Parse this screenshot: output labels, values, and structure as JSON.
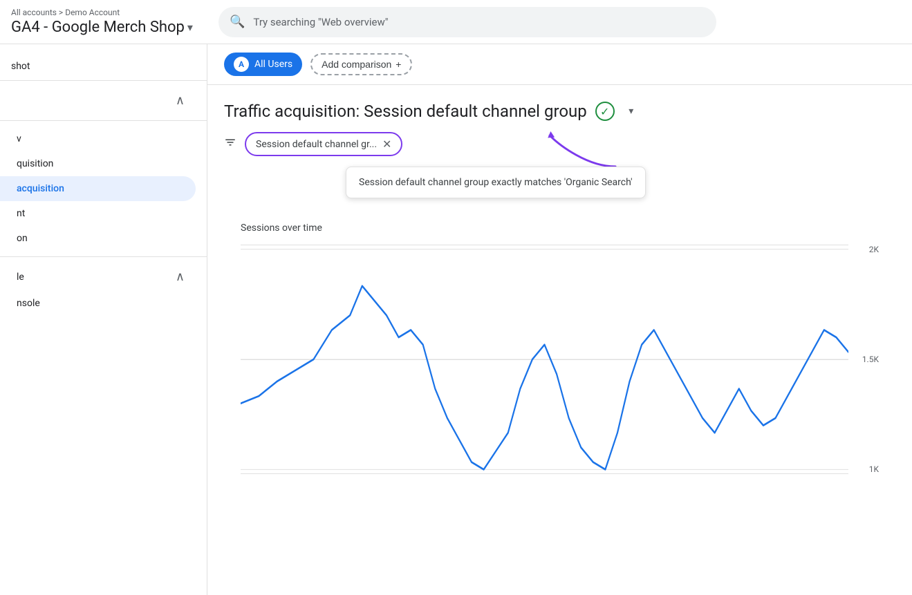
{
  "header": {
    "breadcrumb_part1": "All accounts",
    "breadcrumb_separator": ">",
    "breadcrumb_part2": "Demo Account",
    "app_title": "GA4 - Google Merch Shop",
    "dropdown_symbol": "▾",
    "search_placeholder": "Try searching \"Web overview\""
  },
  "segment_bar": {
    "chip_letter": "A",
    "chip_label": "All Users",
    "add_comparison_label": "Add comparison",
    "add_icon": "+"
  },
  "report": {
    "title": "Traffic acquisition: Session default channel group",
    "filter_icon": "▼",
    "filter_chip_text": "Session default channel gr...",
    "filter_chip_x": "✕",
    "tooltip_text": "Session default channel group exactly matches 'Organic Search'",
    "chart_label": "Sessions over time"
  },
  "sidebar": {
    "items": [
      {
        "label": "shot",
        "indent": true
      },
      {
        "label": "chevron_up",
        "type": "chevron"
      },
      {
        "label": "v"
      },
      {
        "label": "quisition"
      },
      {
        "label": "acquisition",
        "active": true
      },
      {
        "label": "nt"
      },
      {
        "label": "on"
      },
      {
        "label": "le",
        "type": "section_with_chevron"
      },
      {
        "label": "nsole"
      }
    ]
  },
  "chart": {
    "y_labels": [
      "2K",
      "1.5K",
      "1K"
    ],
    "line_color": "#1a73e8"
  },
  "colors": {
    "active_blue": "#1a73e8",
    "active_bg": "#e8f0fe",
    "filter_purple": "#7c3aed",
    "arrow_purple": "#7c3aed",
    "verified_green": "#1e8e3e"
  }
}
